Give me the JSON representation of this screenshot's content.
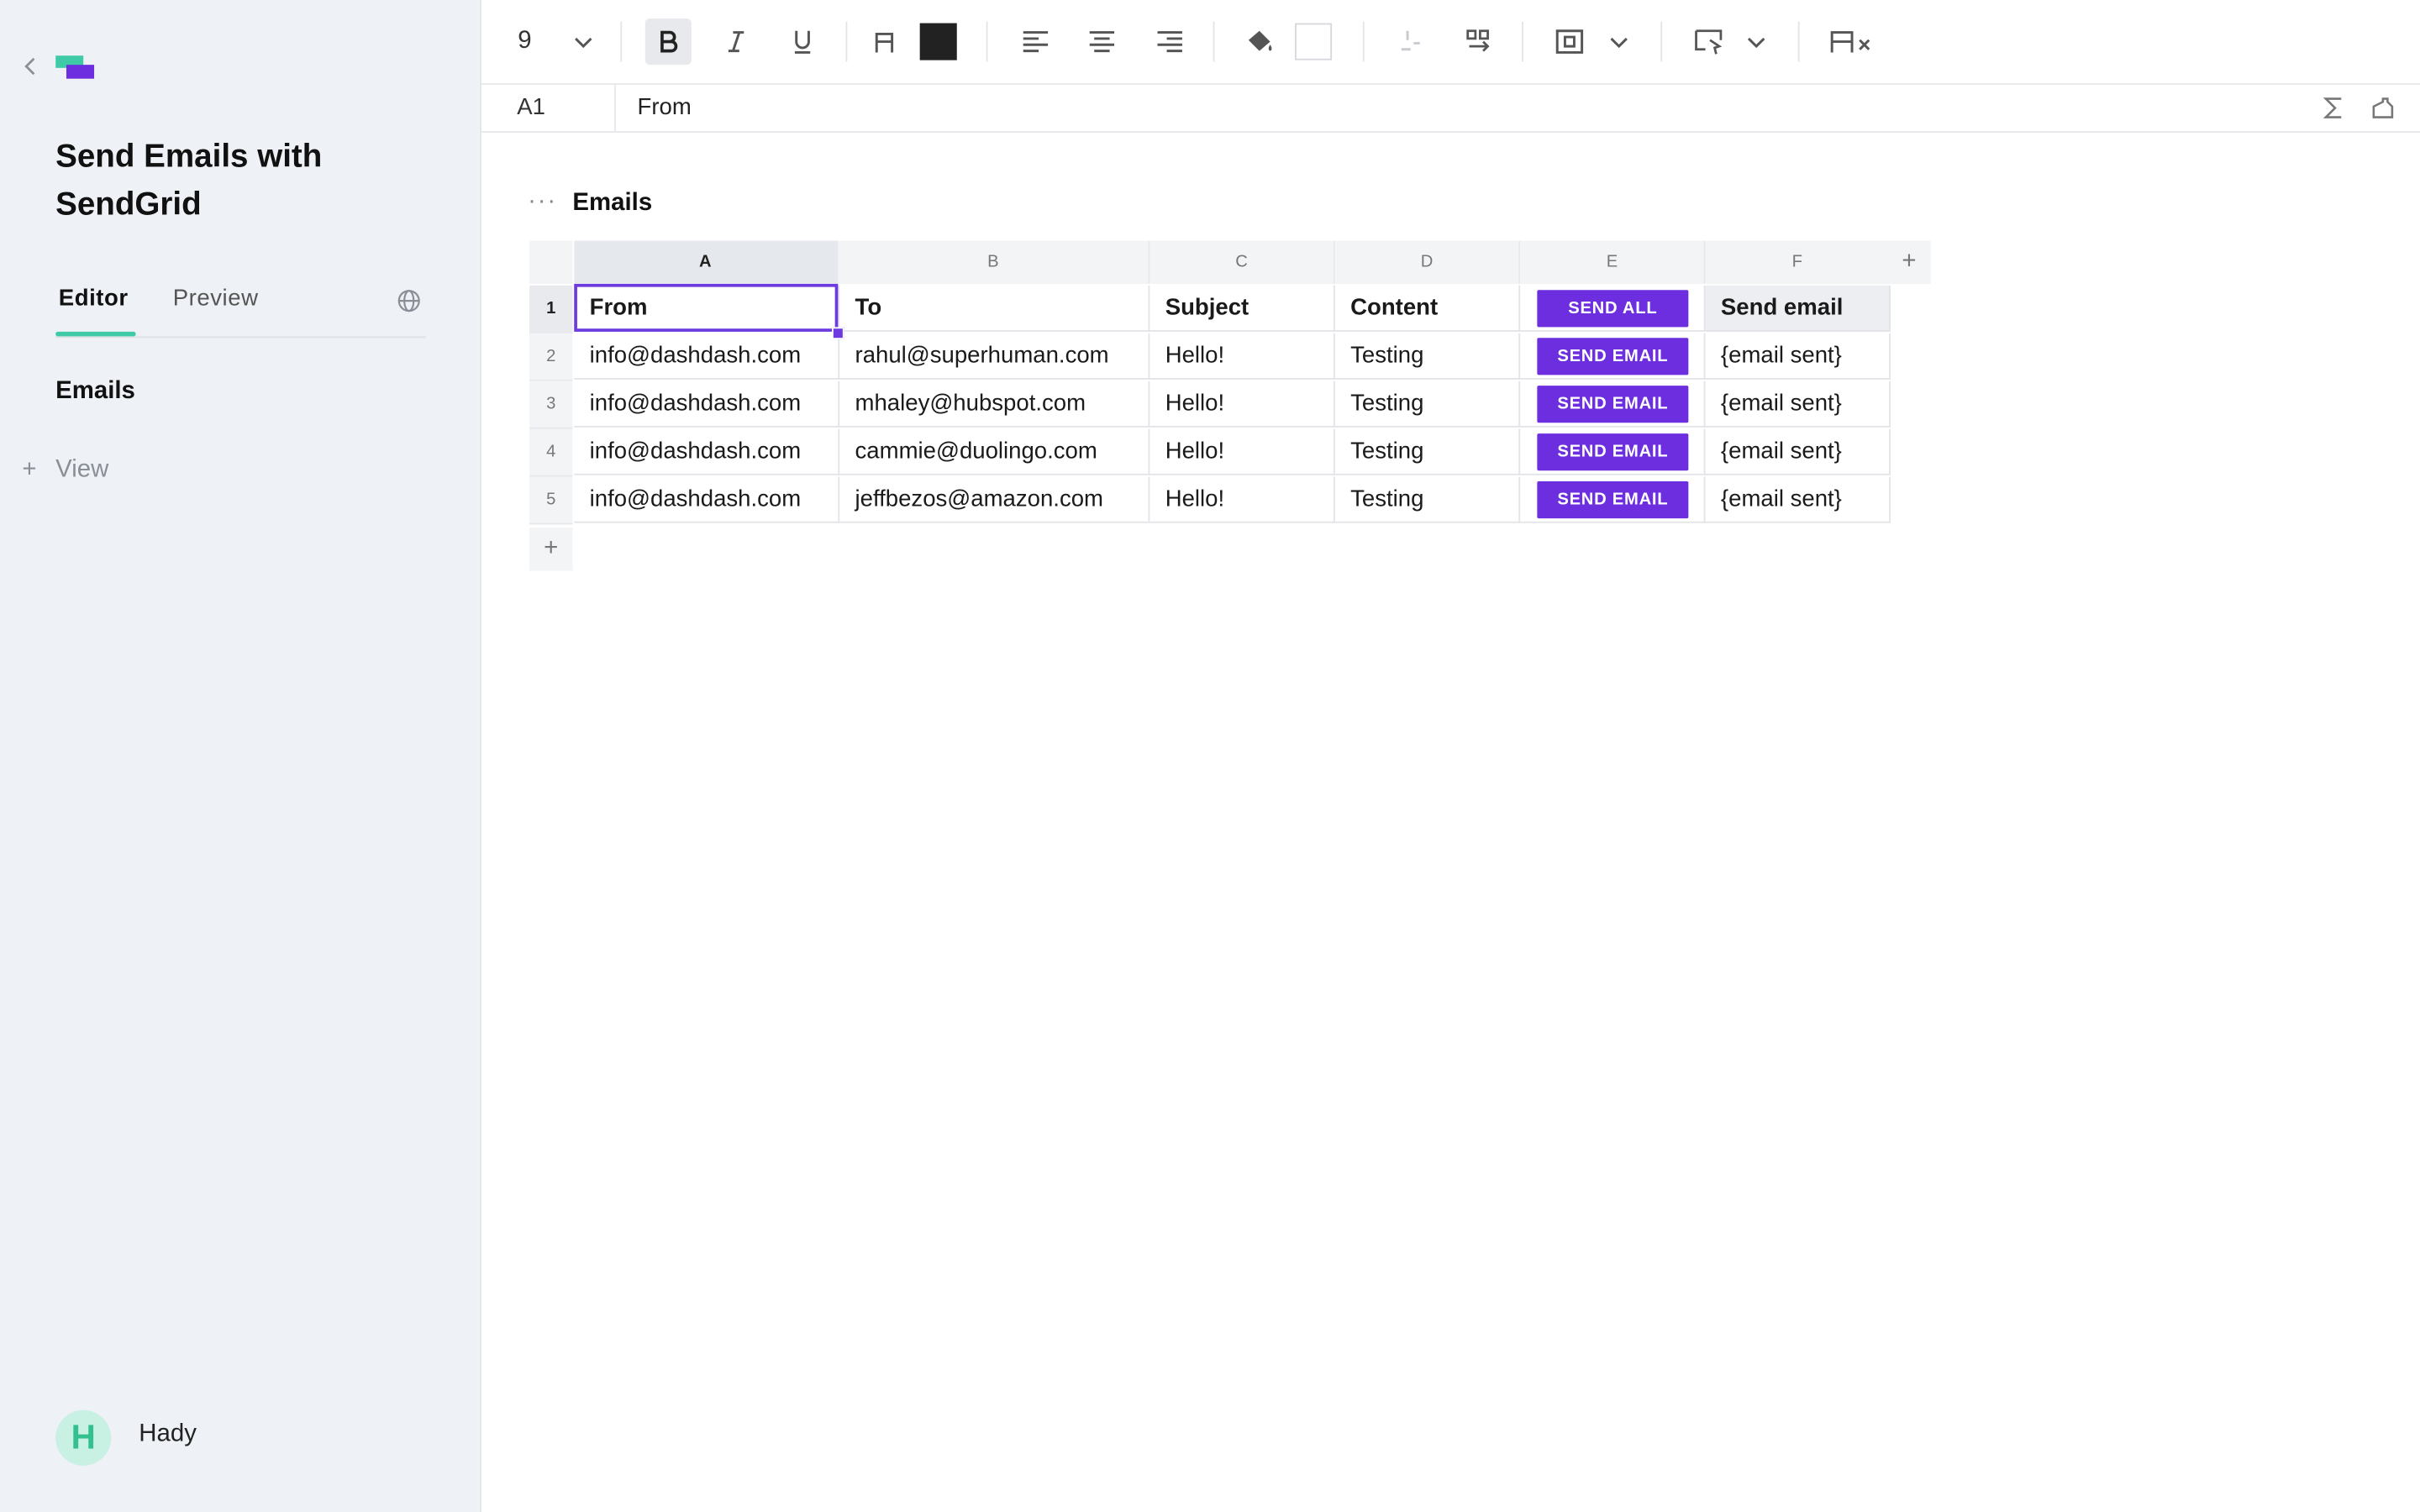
{
  "sidebar": {
    "title": "Send Emails with SendGrid",
    "tabs": [
      {
        "label": "Editor"
      },
      {
        "label": "Preview"
      }
    ],
    "items": [
      {
        "label": "Emails"
      }
    ],
    "add_view_label": "View",
    "user": {
      "initial": "H",
      "name": "Hady"
    }
  },
  "toolbar": {
    "font_size": "9",
    "text_color": "#222222",
    "fill_color": "#ffffff"
  },
  "formula_bar": {
    "cell_ref": "A1",
    "cell_value": "From"
  },
  "sheet": {
    "title": "Emails",
    "columns": [
      "A",
      "B",
      "C",
      "D",
      "E",
      "F"
    ],
    "rows": [
      "1",
      "2",
      "3",
      "4",
      "5"
    ],
    "header": {
      "from": "From",
      "to": "To",
      "subject": "Subject",
      "content": "Content",
      "button": "SEND ALL",
      "status": "Send email"
    },
    "data": [
      {
        "from": "info@dashdash.com",
        "to": "rahul@superhuman.com",
        "subject": "Hello!",
        "content": "Testing",
        "button": "SEND EMAIL",
        "status": "{email sent}"
      },
      {
        "from": "info@dashdash.com",
        "to": "mhaley@hubspot.com",
        "subject": "Hello!",
        "content": "Testing",
        "button": "SEND EMAIL",
        "status": "{email sent}"
      },
      {
        "from": "info@dashdash.com",
        "to": "cammie@duolingo.com",
        "subject": "Hello!",
        "content": "Testing",
        "button": "SEND EMAIL",
        "status": "{email sent}"
      },
      {
        "from": "info@dashdash.com",
        "to": "jeffbezos@amazon.com",
        "subject": "Hello!",
        "content": "Testing",
        "button": "SEND EMAIL",
        "status": "{email sent}"
      }
    ]
  },
  "colors": {
    "accent_purple": "#6d2ee0",
    "accent_green": "#3ec9a7",
    "sidebar_bg": "#eef1f5"
  }
}
